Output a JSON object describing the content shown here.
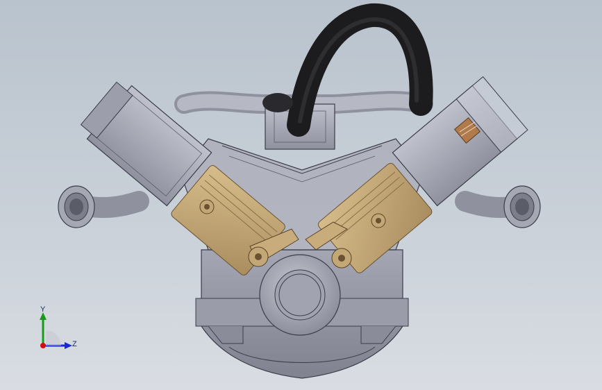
{
  "triad": {
    "y_label": "Y",
    "z_label": "Z",
    "colors": {
      "y": "#1a9a1a",
      "z": "#1a2ad0",
      "x": "#d01010"
    }
  },
  "colors": {
    "background_top": "#b9c3cd",
    "background_bottom": "#d9dde3",
    "metal": "#a7a9b6",
    "metal_dark": "#7e8090",
    "outline": "#3a3c48",
    "piston": "#c6a87a",
    "hose": "#1c1c1e"
  }
}
